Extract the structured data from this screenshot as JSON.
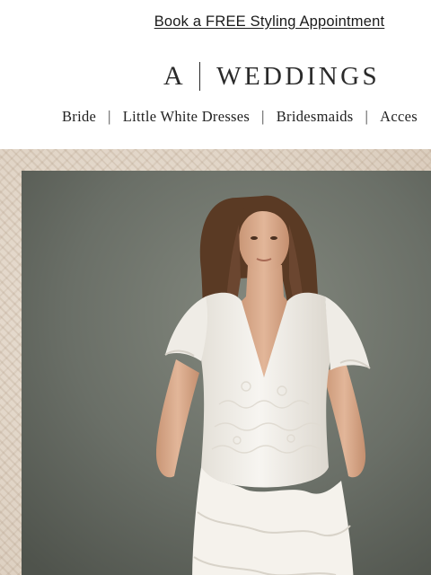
{
  "promo": {
    "text": "Book a FREE Styling Appointment"
  },
  "logo": {
    "mark": "A",
    "wordmark": "WEDDINGS"
  },
  "nav": {
    "items": [
      {
        "label": "Bride"
      },
      {
        "label": "Little White Dresses"
      },
      {
        "label": "Bridesmaids"
      },
      {
        "label": "Acces"
      }
    ],
    "separator": "|"
  },
  "hero": {
    "image": "model-in-white-wedding-dress",
    "colors": {
      "backdrop": "#6b7068",
      "dress": "#f4f1ec",
      "skin": "#d9ab8c",
      "hair": "#5a3a24",
      "frame": "#e1d4c5"
    }
  }
}
